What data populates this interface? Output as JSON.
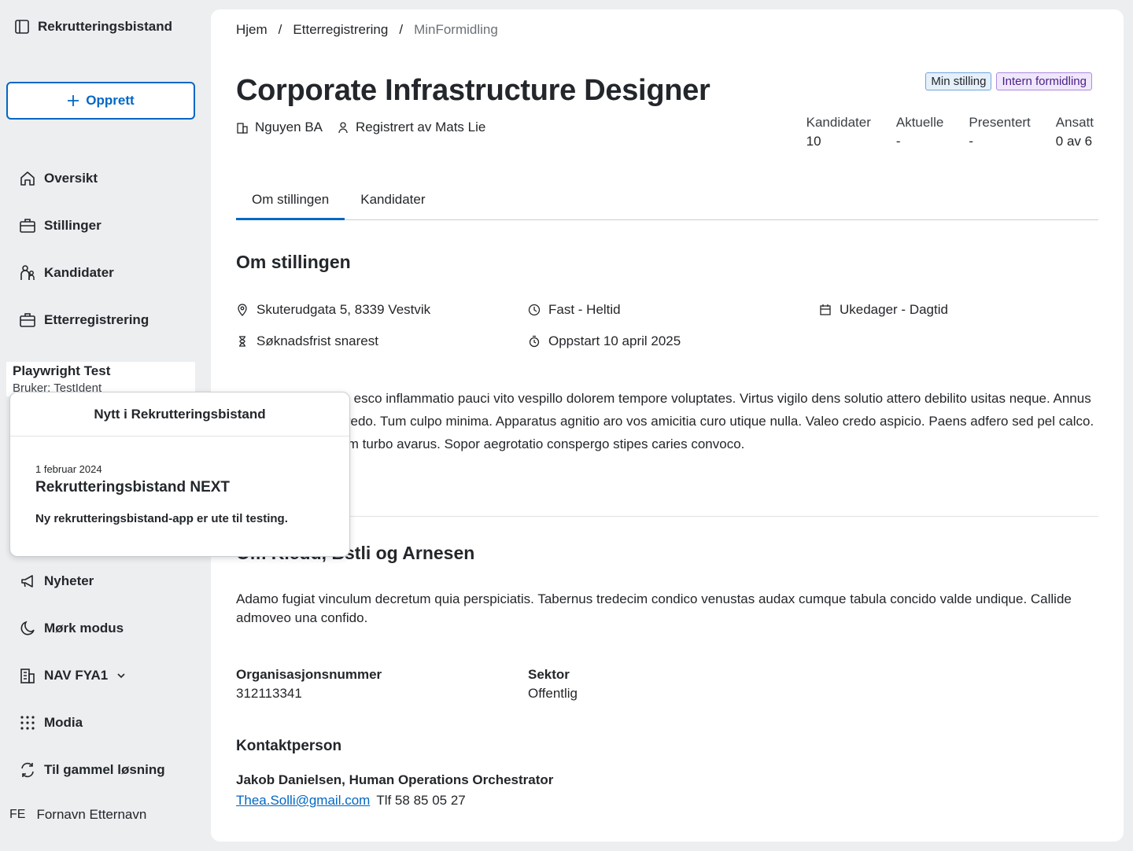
{
  "sidebar": {
    "brand": "Rekrutteringsbistand",
    "create_label": "Opprett",
    "nav_top": [
      {
        "label": "Oversikt",
        "icon": "home-icon"
      },
      {
        "label": "Stillinger",
        "icon": "briefcase-icon"
      },
      {
        "label": "Kandidater",
        "icon": "people-icon"
      },
      {
        "label": "Etterregistrering",
        "icon": "briefcase-icon"
      }
    ],
    "user": {
      "name": "Playwright Test",
      "id": "Bruker: TestIdent"
    },
    "nav_bottom": [
      {
        "label": "Nyheter",
        "icon": "megaphone-icon"
      },
      {
        "label": "Mørk modus",
        "icon": "moon-icon"
      },
      {
        "label": "NAV FYA1",
        "icon": "building-icon"
      },
      {
        "label": "Modia",
        "icon": "grid-icon"
      },
      {
        "label": "Til gammel løsning",
        "icon": "arrows-icon"
      }
    ],
    "avatar_initials": "FE",
    "avatar_name": "Fornavn Etternavn"
  },
  "breadcrumb": [
    "Hjem",
    "Etterregistrering",
    "MinFormidling"
  ],
  "job": {
    "title": "Corporate Infrastructure Designer",
    "employer": "Nguyen BA",
    "registered_by": "Registrert av Mats Lie",
    "tags": [
      "Min stilling",
      "Intern formidling"
    ],
    "stats": [
      {
        "label": "Kandidater",
        "value": "10"
      },
      {
        "label": "Aktuelle",
        "value": "-"
      },
      {
        "label": "Presentert",
        "value": "-"
      },
      {
        "label": "Ansatt",
        "value": "0 av 6"
      }
    ]
  },
  "tabs": [
    "Om stillingen",
    "Kandidater"
  ],
  "about": {
    "heading": "Om stillingen",
    "address": "Skuterudgata 5, 8339 Vestvik",
    "employment": "Fast - Heltid",
    "schedule": "Ukedager - Dagtid",
    "deadline": "Søknadsfrist snarest",
    "start": "Oppstart 10 april 2025",
    "description": "Tunc crapula quam esco inflammatio pauci vito vespillo dolorem tempore voluptates. Virtus vigilo dens solutio attero debilito usitas neque. Annus articulus ea alias credo. Tum culpo minima. Apparatus agnitio aro vos amicitia curo utique nulla. Valeo credo aspicio. Paens adfero sed pel calco. Strenuus conventum turbo avarus. Sopor aegrotatio conspergo stipes caries convoco."
  },
  "employer_section": {
    "heading": "Om Kiedu, Bstli og Arnesen",
    "description": "Adamo fugiat vinculum decretum quia perspiciatis. Tabernus tredecim condico venustas audax cumque tabula concido valde undique. Callide admoveo una confido.",
    "org_label": "Organisasjonsnummer",
    "org_value": "312113341",
    "sector_label": "Sektor",
    "sector_value": "Offentlig",
    "contact_heading": "Kontaktperson",
    "contact_name": "Jakob Danielsen, Human Operations Orchestrator",
    "contact_email": "Thea.Solli@gmail.com",
    "contact_phone": "Tlf 58 85 05 27"
  },
  "popover": {
    "title": "Nytt i Rekrutteringsbistand",
    "date": "1 februar 2024",
    "headline": "Rekrutteringsbistand NEXT",
    "text": "Ny rekrutteringsbistand-app er ute til testing."
  }
}
